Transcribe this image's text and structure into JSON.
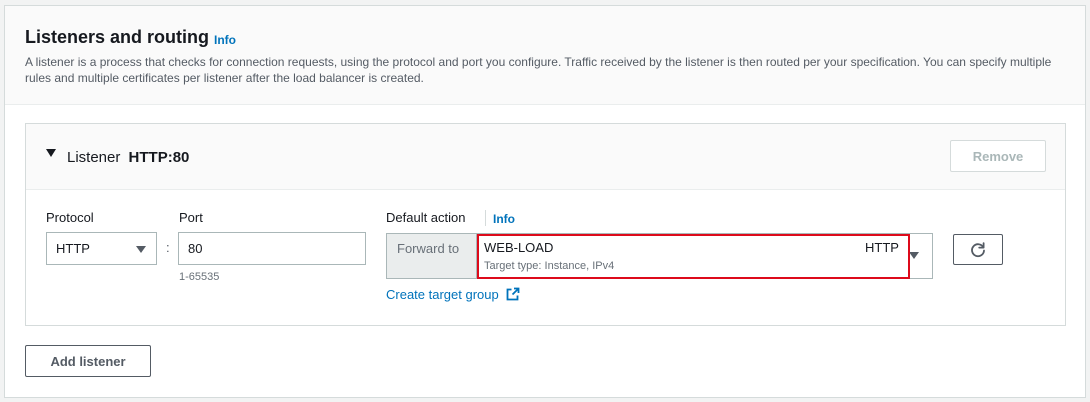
{
  "section": {
    "title": "Listeners and routing",
    "info_label": "Info",
    "description": "A listener is a process that checks for connection requests, using the protocol and port you configure. Traffic received by the listener is then routed per your specification. You can specify multiple rules and multiple certificates per listener after the load balancer is created."
  },
  "listener": {
    "prefix": "Listener",
    "name": "HTTP:80",
    "remove_label": "Remove",
    "protocol": {
      "label": "Protocol",
      "value": "HTTP"
    },
    "port": {
      "label": "Port",
      "value": "80",
      "hint": "1-65535"
    },
    "separator": ":",
    "default_action": {
      "label": "Default action",
      "info_label": "Info",
      "forward_label": "Forward to",
      "target_group_name": "WEB-LOAD",
      "target_group_protocol": "HTTP",
      "target_group_detail": "Target type: Instance, IPv4",
      "create_link": "Create target group"
    }
  },
  "add_listener_label": "Add listener",
  "icons": {
    "expand": "caret-down-icon",
    "refresh": "refresh-icon",
    "external": "external-link-icon",
    "dropdown": "chevron-down-icon"
  },
  "colors": {
    "link": "#0073bb",
    "highlight": "#dd0a1b",
    "border": "#aab7b8"
  }
}
